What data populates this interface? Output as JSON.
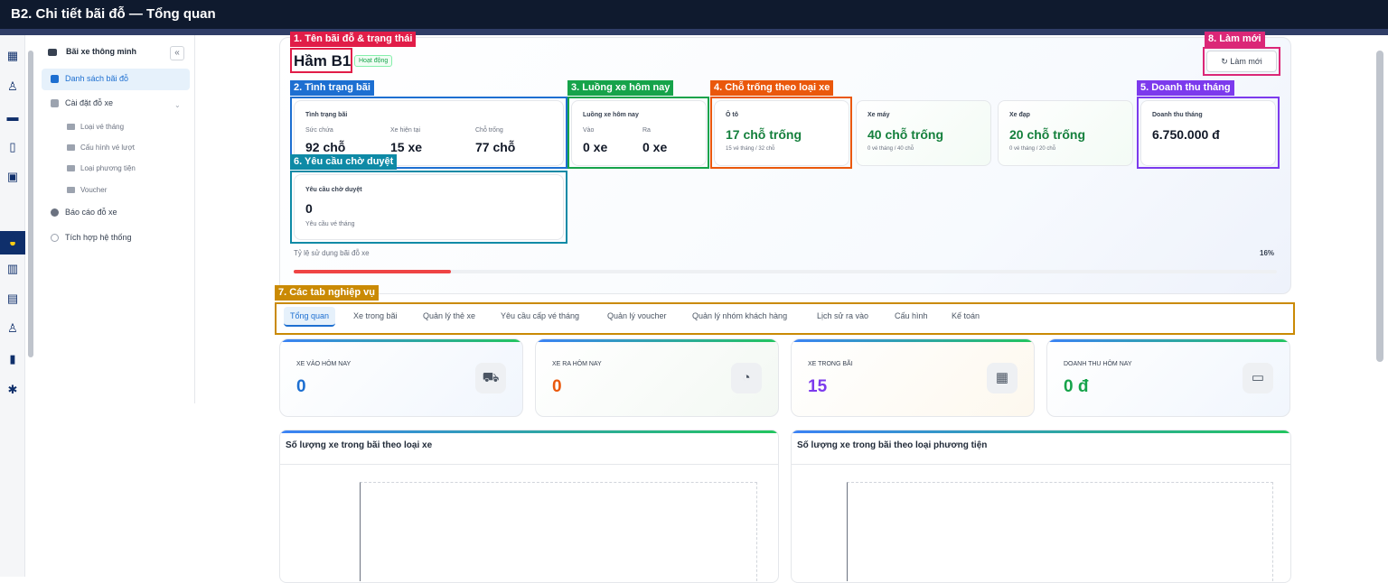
{
  "window_title": "B2. Chi tiết bãi đỗ — Tổng quan",
  "sidebar": {
    "header": "Bãi xe thông minh",
    "collapse_icon": "«",
    "items": [
      {
        "label": "Danh sách bãi đỗ",
        "active": true
      },
      {
        "label": "Cài đặt đỗ xe"
      },
      {
        "label": "Báo cáo đỗ xe"
      },
      {
        "label": "Tích hợp hệ thống"
      }
    ],
    "subitems": [
      "Loại vé tháng",
      "Cấu hình vé lượt",
      "Loại phương tiện",
      "Voucher"
    ]
  },
  "parking": {
    "name": "Hầm B1",
    "status": "Hoạt động",
    "refresh_label": "Làm mới"
  },
  "annotations": {
    "a1": "1. Tên bãi đỗ & trạng thái",
    "a2": "2. Tình trạng bãi",
    "a3": "3. Luồng xe hôm nay",
    "a4": "4. Chỗ trống theo loại xe",
    "a5": "5. Doanh thu tháng",
    "a6": "6. Yêu cầu chờ duyệt",
    "a7": "7. Các tab nghiệp vụ",
    "a8": "8. Làm mới"
  },
  "status_card": {
    "title": "Tình trạng bãi",
    "capacity_label": "Sức chứa",
    "capacity": "92 chỗ",
    "current_label": "Xe hiện tại",
    "current": "15 xe",
    "free_label": "Chỗ trống",
    "free": "77 chỗ"
  },
  "flow_card": {
    "title": "Luồng xe hôm nay",
    "in_label": "Vào",
    "in": "0 xe",
    "out_label": "Ra",
    "out": "0 xe"
  },
  "vehicle_cards": [
    {
      "type": "Ô tô",
      "free": "17 chỗ trống",
      "detail": "15 vé tháng / 32 chỗ"
    },
    {
      "type": "Xe máy",
      "free": "40 chỗ trống",
      "detail": "0 vé tháng / 40 chỗ"
    },
    {
      "type": "Xe đạp",
      "free": "20 chỗ trống",
      "detail": "0 vé tháng / 20 chỗ"
    }
  ],
  "revenue_card": {
    "title": "Doanh thu tháng",
    "value": "6.750.000 đ"
  },
  "pending_card": {
    "title": "Yêu cầu chờ duyệt",
    "value": "0",
    "detail": "Yêu cầu vé tháng"
  },
  "utilization": {
    "label": "Tỷ lệ sử dụng bãi đỗ xe",
    "percent_text": "16%",
    "fraction": 0.16
  },
  "tabs": [
    "Tổng quan",
    "Xe trong bãi",
    "Quản lý thẻ xe",
    "Yêu cầu cấp vé tháng",
    "Quản lý voucher",
    "Quản lý nhóm khách hàng",
    "Lịch sử ra vào",
    "Cấu hình",
    "Kế toán"
  ],
  "stats": [
    {
      "label": "XE VÀO HÔM NAY",
      "value": "0",
      "color": "#1d6fd1",
      "icon": "car-icon"
    },
    {
      "label": "XE RA HÔM NAY",
      "value": "0",
      "color": "#ea580c",
      "icon": "clock-icon"
    },
    {
      "label": "XE TRONG BÃI",
      "value": "15",
      "color": "#7c3aed",
      "icon": "grid-icon"
    },
    {
      "label": "DOANH THU HÔM NAY",
      "value": "0 đ",
      "color": "#16a34a",
      "icon": "wallet-icon"
    }
  ],
  "panels": [
    "Số lượng xe trong bãi theo loại xe",
    "Số lượng xe trong bãi theo loại phương tiện"
  ]
}
